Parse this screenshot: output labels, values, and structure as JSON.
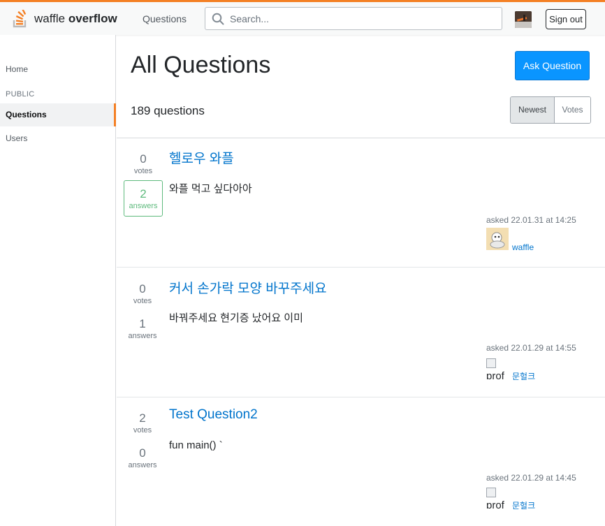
{
  "header": {
    "logo_light": "waffle",
    "logo_bold": "overflow",
    "nav_questions": "Questions",
    "search_placeholder": "Search...",
    "sign_out": "Sign out",
    "accent_color": "#f48024"
  },
  "sidebar": {
    "home": "Home",
    "section_label": "PUBLIC",
    "questions": "Questions",
    "users": "Users"
  },
  "main": {
    "title": "All Questions",
    "ask_button": "Ask Question",
    "count": "189 questions",
    "filters": [
      "Newest",
      "Votes"
    ],
    "active_filter": "Newest"
  },
  "questions": [
    {
      "votes": "0",
      "votes_label": "votes",
      "answers": "2",
      "answers_label": "answers",
      "answered": true,
      "title": "헬로우 와플",
      "body": "와플 먹고 싶다아아",
      "asked": "asked 22.01.31 at 14:25",
      "user": "waffle",
      "avatar": "image"
    },
    {
      "votes": "0",
      "votes_label": "votes",
      "answers": "1",
      "answers_label": "answers",
      "answered": false,
      "title": "커서 손가락 모양 바꾸주세요",
      "body": "바꿔주세요 현기증 났어요 이미",
      "asked": "asked 22.01.29 at 14:55",
      "user": "문헐크",
      "avatar_alt": "prof"
    },
    {
      "votes": "2",
      "votes_label": "votes",
      "answers": "0",
      "answers_label": "answers",
      "answered": false,
      "title": "Test Question2",
      "body": "fun main() `",
      "asked": "asked 22.01.29 at 14:45",
      "user": "문헐크",
      "avatar_alt": "prof"
    }
  ]
}
